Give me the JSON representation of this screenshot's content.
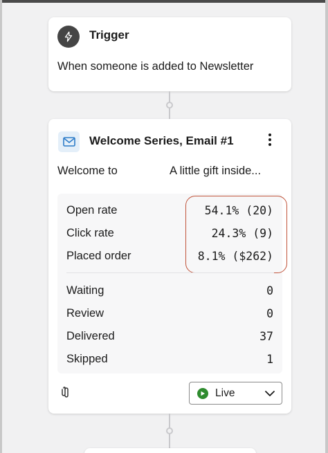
{
  "trigger": {
    "title": "Trigger",
    "description": "When someone is added to Newsletter",
    "icon": "lightning-bolt-icon"
  },
  "email": {
    "title": "Welcome Series, Email #1",
    "icon": "mail-icon",
    "subject_preview": "Welcome to",
    "preview_text": "A little gift inside...",
    "performance": [
      {
        "label": "Open rate",
        "value": "54.1% (20)"
      },
      {
        "label": "Click rate",
        "value": "24.3% (9)"
      },
      {
        "label": "Placed order",
        "value": "8.1% ($262)"
      }
    ],
    "counts": [
      {
        "label": "Waiting",
        "value": "0"
      },
      {
        "label": "Review",
        "value": "0"
      },
      {
        "label": "Delivered",
        "value": "37"
      },
      {
        "label": "Skipped",
        "value": "1"
      }
    ],
    "status": {
      "label": "Live",
      "color": "#2e8b2e"
    },
    "highlight_color": "#c0533a"
  }
}
